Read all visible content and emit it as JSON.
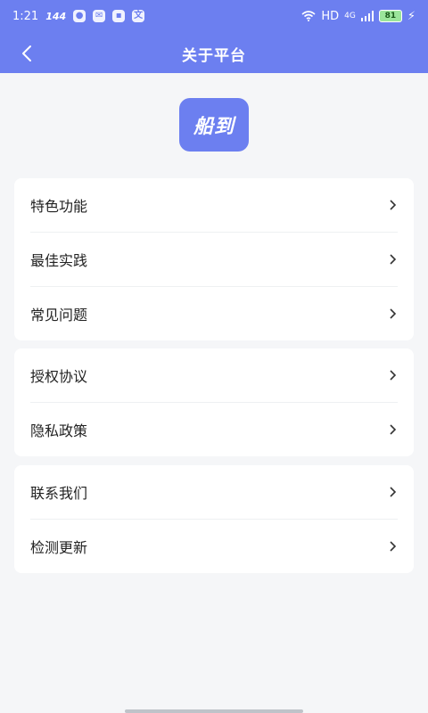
{
  "status_bar": {
    "time": "1:21",
    "refresh_rate": "144",
    "network": "HD",
    "signal_type": "4G",
    "battery": "81"
  },
  "nav": {
    "title": "关于平台"
  },
  "logo": {
    "text": "船到"
  },
  "groups": [
    {
      "items": [
        {
          "label": "特色功能"
        },
        {
          "label": "最佳实践"
        },
        {
          "label": "常见问题"
        }
      ]
    },
    {
      "items": [
        {
          "label": "授权协议"
        },
        {
          "label": "隐私政策"
        }
      ]
    },
    {
      "items": [
        {
          "label": "联系我们"
        },
        {
          "label": "检测更新"
        }
      ]
    }
  ],
  "colors": {
    "primary": "#6c7ff0",
    "background": "#f5f6f8",
    "card": "#ffffff",
    "text": "#222222"
  }
}
